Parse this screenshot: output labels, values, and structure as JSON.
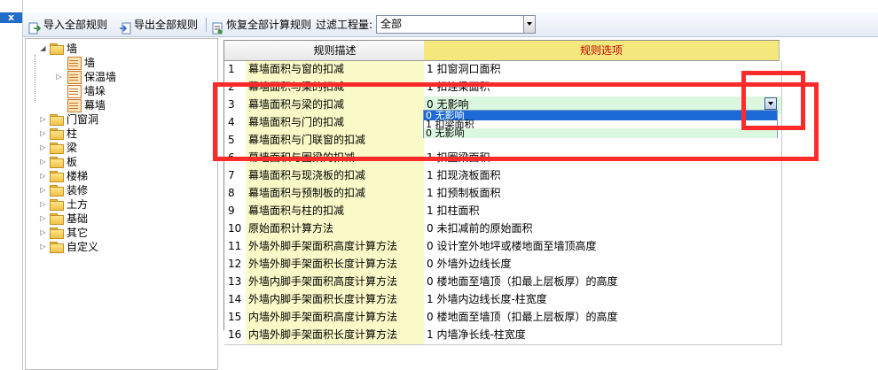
{
  "strip": {
    "close_label": "x"
  },
  "toolbar": {
    "import_label": "导入全部规则",
    "export_label": "导出全部规则",
    "restore_label": "恢复全部计算规则",
    "filter_label": "过滤工程量:",
    "filter_value": "全部"
  },
  "tree": {
    "root": {
      "label": "墙",
      "expander": "◢"
    },
    "children": [
      {
        "label": "墙"
      },
      {
        "label": "保温墙",
        "expander": "▷"
      },
      {
        "label": "墙垛"
      },
      {
        "label": "幕墙"
      }
    ],
    "folders": [
      {
        "label": "门窗洞",
        "expander": "▷"
      },
      {
        "label": "柱",
        "expander": "▷"
      },
      {
        "label": "梁",
        "expander": "▷"
      },
      {
        "label": "板",
        "expander": "▷"
      },
      {
        "label": "楼梯",
        "expander": "▷"
      },
      {
        "label": "装修",
        "expander": "▷"
      },
      {
        "label": "土方",
        "expander": "▷"
      },
      {
        "label": "基础",
        "expander": "▷"
      },
      {
        "label": "其它",
        "expander": "▷"
      },
      {
        "label": "自定义",
        "expander": "▷"
      }
    ]
  },
  "grid": {
    "headers": {
      "desc": "规则描述",
      "option": "规则选项"
    },
    "header_option_color": "#c00000",
    "rows": [
      {
        "idx": "1",
        "desc": "幕墙面积与窗的扣减",
        "option": "1  扣窗洞口面积"
      },
      {
        "idx": "2",
        "desc": "幕墙面积与梁的扣减",
        "option": "1  扣连梁面积"
      },
      {
        "idx": "3",
        "desc": "幕墙面积与梁的扣减",
        "option": "0   无影响"
      },
      {
        "idx": "4",
        "desc": "幕墙面积与门的扣减",
        "option": ""
      },
      {
        "idx": "5",
        "desc": "幕墙面积与门联窗的扣减",
        "option": ""
      },
      {
        "idx": "6",
        "desc": "幕墙面积与圈梁的扣减",
        "option": "1  扣圈梁面积"
      },
      {
        "idx": "7",
        "desc": "幕墙面积与现浇板的扣减",
        "option": "1  扣现浇板面积"
      },
      {
        "idx": "8",
        "desc": "幕墙面积与预制板的扣减",
        "option": "1  扣预制板面积"
      },
      {
        "idx": "9",
        "desc": "幕墙面积与柱的扣减",
        "option": "1  扣柱面积"
      },
      {
        "idx": "10",
        "desc": "原始面积计算方法",
        "option": "0  未扣减前的原始面积"
      },
      {
        "idx": "11",
        "desc": "外墙外脚手架面积高度计算方法",
        "option": "0  设计室外地坪或楼地面至墙顶高度"
      },
      {
        "idx": "12",
        "desc": "外墙外脚手架面积长度计算方法",
        "option": "0  外墙外边线长度"
      },
      {
        "idx": "13",
        "desc": "外墙内脚手架面积高度计算方法",
        "option": "0  楼地面至墙顶（扣最上层板厚）的高度"
      },
      {
        "idx": "14",
        "desc": "外墙内脚手架面积长度计算方法",
        "option": "1  外墙内边线长度-柱宽度"
      },
      {
        "idx": "15",
        "desc": "内墙外脚手架面积高度计算方法",
        "option": "0  楼地面至墙顶（扣最上层板厚）的高度"
      },
      {
        "idx": "16",
        "desc": "内墙外脚手架面积长度计算方法",
        "option": "1  内墙净长线-柱宽度"
      }
    ],
    "dropdown_options": [
      {
        "label": "0   无影响",
        "selected": true
      },
      {
        "label": "1  扣梁面积",
        "selected": false
      },
      {
        "label": "0   无影响",
        "selected": false
      }
    ]
  },
  "colors": {
    "selection": "#1c6ad6",
    "desc_bg": "#fafac8",
    "selected_row_bg": "#dcf7df",
    "annotation": "#ff2b2b"
  }
}
